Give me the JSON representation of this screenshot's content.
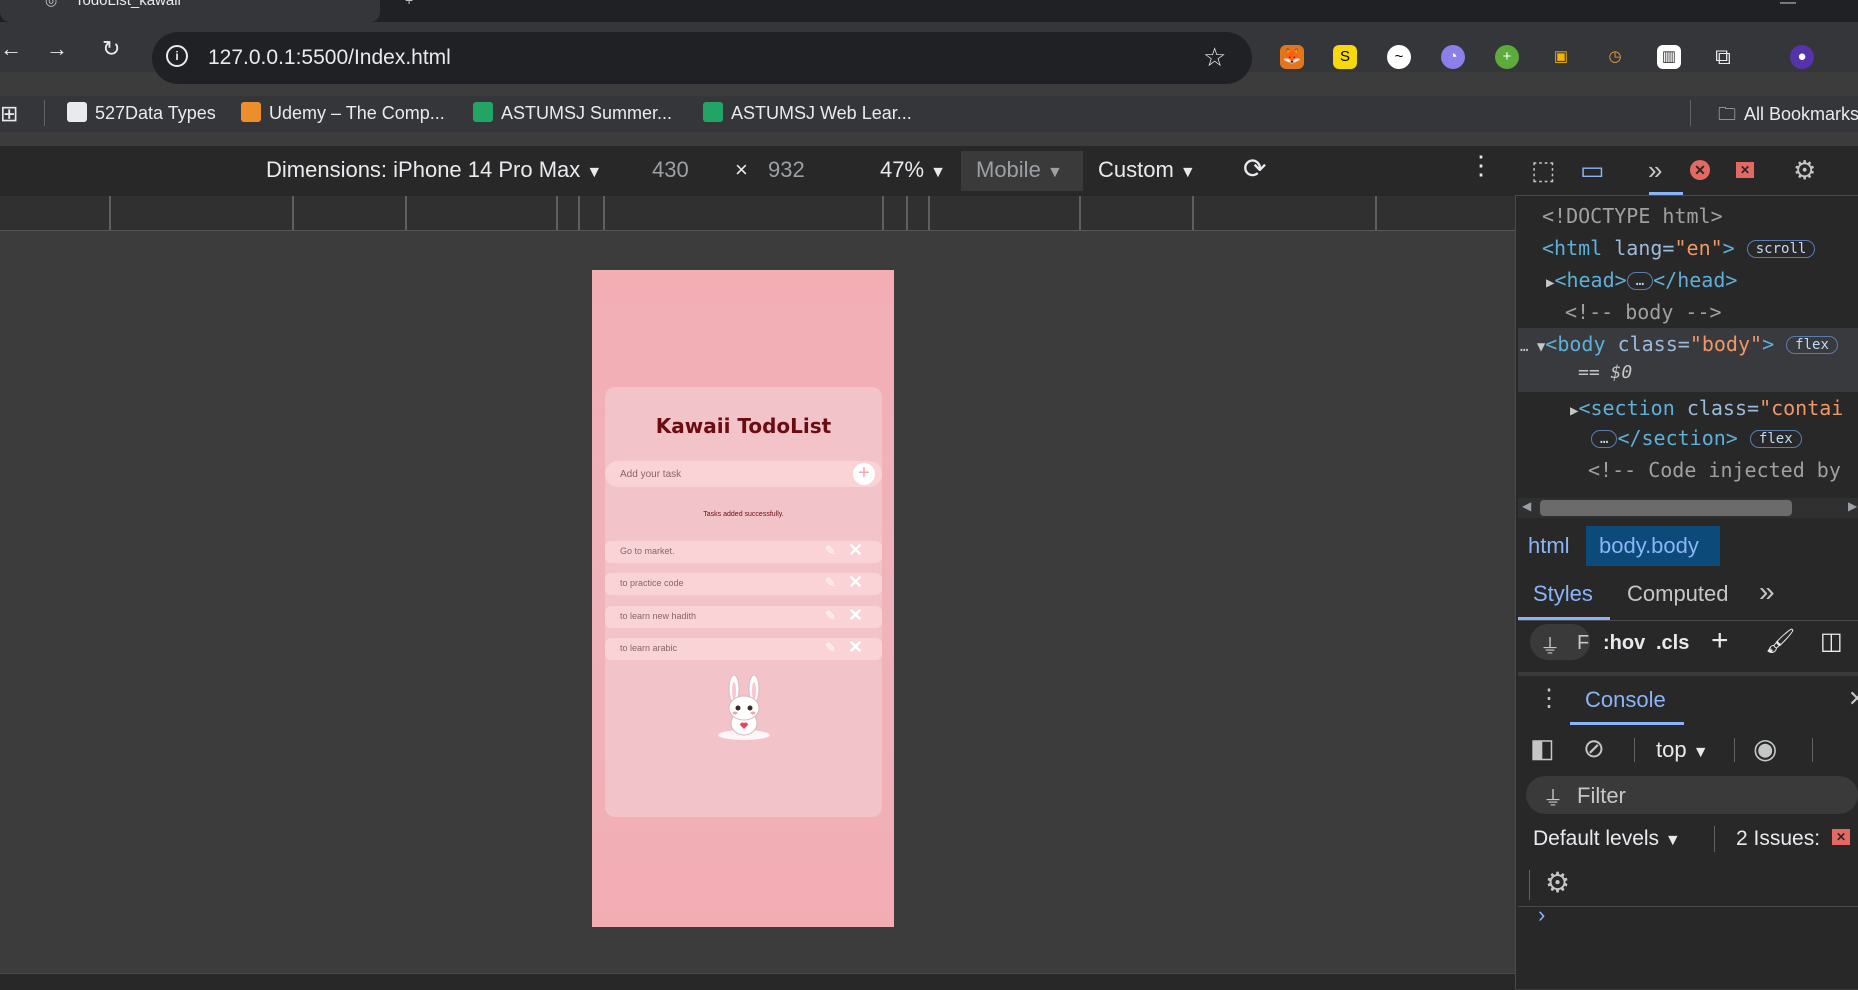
{
  "browser": {
    "tab_title": "TodoList_kawaii",
    "url": "127.0.0.1:5500/Index.html",
    "bookmarks": [
      "527Data Types",
      "Udemy – The Comp...",
      "ASTUMSJ Summer...",
      "ASTUMSJ Web Lear...",
      "All Bookmarks"
    ]
  },
  "device_toolbar": {
    "dimensions": "Dimensions: iPhone 14 Pro Max",
    "width": "430",
    "times": "×",
    "height": "932",
    "zoom": "47%",
    "mode": "Mobile",
    "throttle": "Custom"
  },
  "app": {
    "title": "Kawaii TodoList",
    "input_placeholder": "Add your task",
    "add_symbol": "+",
    "status": "Tasks added successfully.",
    "tasks": [
      "Go to market.",
      "to practice code",
      "to learn new hadith",
      "to learn arabic"
    ]
  },
  "devtools": {
    "doctype": "<!DOCTYPE html>",
    "html_open": "<html",
    "lang_attr": "lang=",
    "lang_val": "\"en\"",
    "close_angle": ">",
    "scroll_pill": "scroll",
    "head": "<head>",
    "head_close": "</head>",
    "ellipsis": "…",
    "body_comment": "<!-- body -->",
    "body_open": "<body",
    "class_attr": "class=",
    "body_class": "\"body\"",
    "flex_pill": "flex",
    "dollar0": "== $0",
    "section_open": "<section",
    "section_class": "\"contai",
    "section_close": "</section>",
    "injected_comment": "<!-- Code injected by",
    "crumb_html": "html",
    "crumb_body": "body.body",
    "tab_styles": "Styles",
    "tab_computed": "Computed",
    "more": "»",
    "filter_short": "F",
    "hov": ":hov",
    "cls": ".cls",
    "console_tab": "Console",
    "context": "top",
    "filter": "Filter",
    "levels": "Default levels",
    "issues": "2 Issues:",
    "prompt": "›"
  },
  "colors": {
    "phone_bg": "#f3aeb4",
    "card_bg": "#f2c3c8",
    "title_color": "#6a0d12",
    "devtools_accent": "#8ab4f8"
  }
}
